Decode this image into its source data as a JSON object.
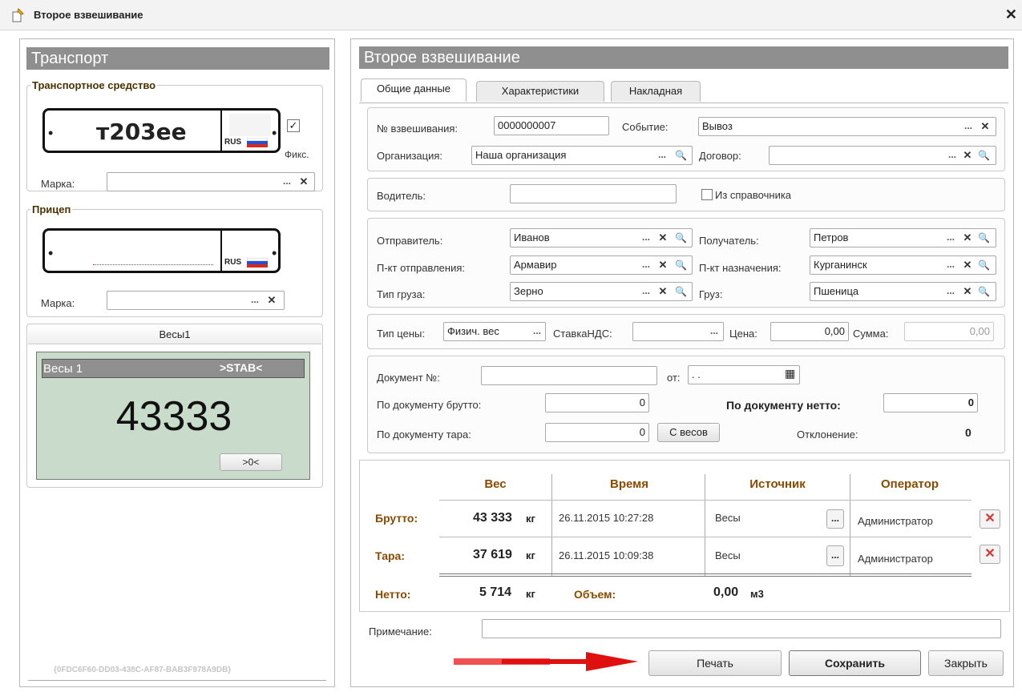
{
  "window": {
    "title": "Второе взвешивание",
    "close_icon": "close-icon"
  },
  "left": {
    "header": "Транспорт",
    "vehicle": {
      "legend": "Транспортное средство",
      "plate_number": "т203ее",
      "plate_country": "RUS",
      "fix_checked": true,
      "fix_label": "Фикс.",
      "brand_label": "Марка:",
      "brand_value": ""
    },
    "trailer": {
      "legend": "Прицеп",
      "plate_number": "",
      "plate_country": "RUS",
      "brand_label": "Марка:",
      "brand_value": ""
    },
    "scales_tab": "Весы1",
    "scale": {
      "name": "Весы 1",
      "status": ">STAB<",
      "reading": "43333",
      "zero_label": ">0<"
    },
    "guid": "{0FDC6F60-DD03-438C-AF87-BAB3F978A9DB}"
  },
  "main": {
    "header": "Второе взвешивание",
    "tabs": [
      {
        "label": "Общие данные"
      },
      {
        "label": "Характеристики"
      },
      {
        "label": "Накладная"
      }
    ],
    "general": {
      "weigh_no_label": "№ взвешивания:",
      "weigh_no": "0000000007",
      "event_label": "Событие:",
      "event": "Вывоз",
      "org_label": "Организация:",
      "org": "Наша организация",
      "contract_label": "Договор:",
      "contract": ""
    },
    "driver": {
      "label": "Водитель:",
      "value": "",
      "from_ref_label": "Из справочника",
      "from_ref_checked": false
    },
    "parties": {
      "sender_label": "Отправитель:",
      "sender": "Иванов",
      "receiver_label": "Получатель:",
      "receiver": "Петров",
      "from_label": "П-кт отправления:",
      "from": "Армавир",
      "to_label": "П-кт назначения:",
      "to": "Курганинск",
      "cargo_type_label": "Тип груза:",
      "cargo_type": "Зерно",
      "cargo_label": "Груз:",
      "cargo": "Пшеница"
    },
    "price": {
      "type_label": "Тип цены:",
      "type": "Физич. вес",
      "vat_label": "СтавкаНДС:",
      "vat": "",
      "price_label": "Цена:",
      "price": "0,00",
      "sum_label": "Сумма:",
      "sum": "0,00"
    },
    "document": {
      "no_label": "Документ №:",
      "no": "",
      "from_label": "от:",
      "date": ". .",
      "gross_label": "По документу брутто:",
      "gross": "0",
      "net_label": "По документу нетто:",
      "net": "0",
      "tare_label": "По документу тара:",
      "tare": "0",
      "from_scales_label": "С весов",
      "deviation_label": "Отклонение:",
      "deviation": "0"
    },
    "weights": {
      "headers": {
        "weight": "Вес",
        "time": "Время",
        "source": "Источник",
        "operator": "Оператор"
      },
      "rows": [
        {
          "label": "Брутто:",
          "weight": "43 333",
          "unit": "кг",
          "time": "26.11.2015 10:27:28",
          "source": "Весы",
          "operator": "Администратор"
        },
        {
          "label": "Тара:",
          "weight": "37 619",
          "unit": "кг",
          "time": "26.11.2015 10:09:38",
          "source": "Весы",
          "operator": "Администратор"
        }
      ],
      "net_label": "Нетто:",
      "net": "5 714",
      "net_unit": "кг",
      "volume_label": "Объем:",
      "volume": "0,00",
      "volume_unit": "м3"
    },
    "note_label": "Примечание:",
    "note": "",
    "buttons": {
      "print": "Печать",
      "save": "Сохранить",
      "close": "Закрыть"
    }
  },
  "colors": {
    "header_bg": "#8f8f8f",
    "accent_brown": "#8a4a00",
    "scale_bg": "#c9dccb",
    "arrow": "#e01010"
  }
}
